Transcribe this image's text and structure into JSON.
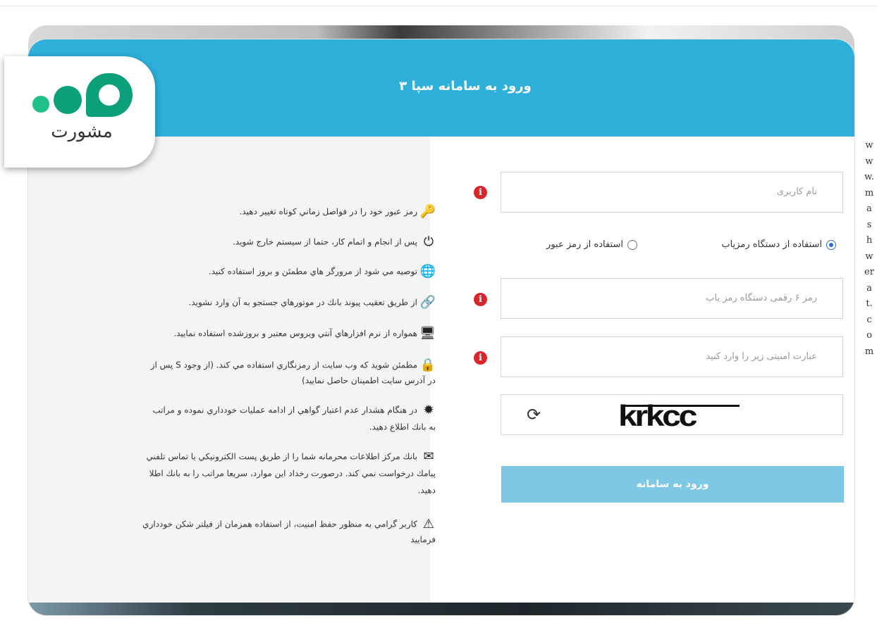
{
  "header": {
    "title": "ورود به سامانه سپا ۳"
  },
  "logo": {
    "word": "مشورت"
  },
  "tips": [
    {
      "icon": "key-icon",
      "glyph": "🔑",
      "text": "رمز عبور خود را در فواصل زماني كوتاه تغيير دهيد."
    },
    {
      "icon": "power-icon",
      "glyph": "⏻",
      "text": "پس از انجام و اتمام كار، حتما از سيستم خارج شويد."
    },
    {
      "icon": "globe-icon",
      "glyph": "🌐",
      "text": "توصيه مي شود از مرورگر هاي مطمئن و بروز استفاده كنيد."
    },
    {
      "icon": "link-icon",
      "glyph": "🔗",
      "text": "از طريق تعقيب پيوند بانك در موتورهاي جستجو به آن وارد نشويد."
    },
    {
      "icon": "monitor-icon",
      "glyph": "🖥",
      "text": "همواره از نرم افزارهاي آنتي ويروس معتبر و بروزشده استفاده نماييد."
    },
    {
      "icon": "lock-icon",
      "glyph": "🔒",
      "text": "مطمئن شويد كه وب سايت از رمزنگاري استفاده مي كند. (از وجود S پس از",
      "text2": "در آدرس سايت اطمينان حاصل نماييد)"
    },
    {
      "icon": "certificate-icon",
      "glyph": "✹",
      "text": "در هنگام هشدار عدم اعتبار گواهي از ادامه عمليات خودداري نموده و مراتب",
      "text2": "به بانك اطلاع دهيد."
    },
    {
      "icon": "envelope-icon",
      "glyph": "✉",
      "text": "بانك مركز اطلاعات محرمانه شما را از طريق پست الكترونيكي يا تماس تلفني",
      "text2": "پيامك درخواست نمي كند. درصورت رخداد اين موارد، سريعا مراتب را به بانك اطلا",
      "text3": "دهيد."
    },
    {
      "icon": "warning-icon",
      "glyph": "⚠",
      "text": "كاربر گرامي به منظور حفظ امنيت، از استفاده همزمان از فيلتر شكن خودداري",
      "text2": "فرماييد"
    }
  ],
  "form": {
    "username_placeholder": "نام کاربری",
    "radio_token": "استفاده از دستگاه رمزیاب",
    "radio_password": "استفاده از رمز عبور",
    "otp_placeholder": "رمز ۶ رقمی دستگاه رمز یاب",
    "captcha_placeholder": "عبارت امنیتی زیر را وارد کنید",
    "captcha_text": "krkcc",
    "submit_label": "ورود به سامانه",
    "error_mark": "i"
  },
  "watermark": "www.mashwerat.com"
}
